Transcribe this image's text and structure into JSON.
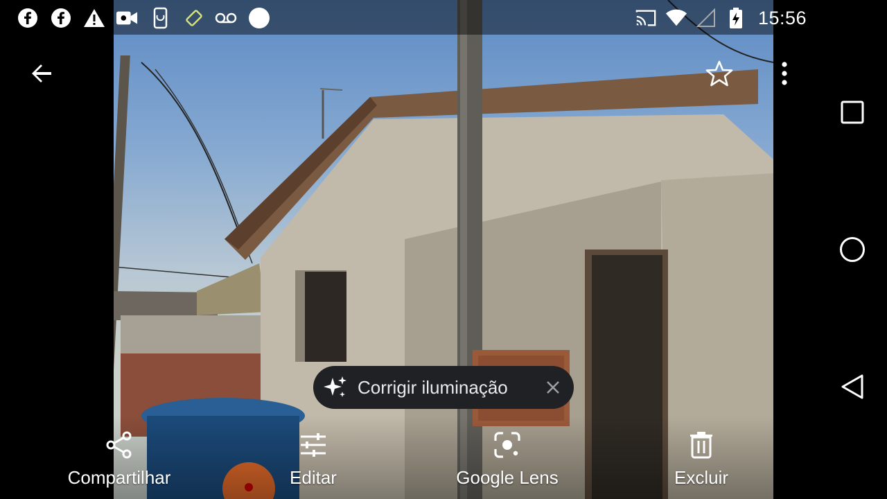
{
  "status_bar": {
    "time": "15:56",
    "left_icons": [
      "facebook-icon",
      "facebook-icon",
      "warning-icon",
      "video-camera-icon",
      "phone-rotate-icon",
      "screen-rotation-icon",
      "voicemail-icon",
      "circle-notification-icon"
    ],
    "right_icons": [
      "cast-icon",
      "wifi-icon",
      "signal-icon",
      "battery-charging-icon"
    ]
  },
  "top_bar": {
    "back_icon": "arrow-back-icon",
    "favorite_icon": "star-outline-icon",
    "more_icon": "more-vert-icon"
  },
  "suggestion_chip": {
    "icon": "sparkle-icon",
    "label": "Corrigir iluminação",
    "close_icon": "close-icon"
  },
  "actions": [
    {
      "label": "Compartilhar",
      "icon": "share-icon"
    },
    {
      "label": "Editar",
      "icon": "tune-icon"
    },
    {
      "label": "Google Lens",
      "icon": "google-lens-icon"
    },
    {
      "label": "Excluir",
      "icon": "trash-icon"
    }
  ],
  "nav_bar": {
    "recents_icon": "square-icon",
    "home_icon": "circle-icon",
    "back_icon": "triangle-back-icon"
  },
  "colors": {
    "chip_background": "#202124",
    "status_bar_tint": "#000000",
    "icon_white": "#ffffff"
  }
}
